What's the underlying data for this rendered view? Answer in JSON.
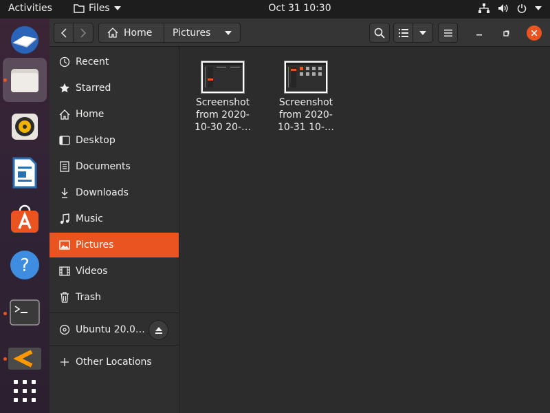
{
  "topbar": {
    "activities": "Activities",
    "app_name": "Files",
    "clock": "Oct 31  10:30"
  },
  "header": {
    "path": [
      {
        "label": "Home",
        "icon": "home-icon"
      },
      {
        "label": "Pictures"
      }
    ]
  },
  "sidebar": {
    "items": [
      {
        "label": "Recent",
        "icon": "clock-icon"
      },
      {
        "label": "Starred",
        "icon": "star-icon"
      },
      {
        "label": "Home",
        "icon": "home-icon"
      },
      {
        "label": "Desktop",
        "icon": "desktop-icon"
      },
      {
        "label": "Documents",
        "icon": "document-icon"
      },
      {
        "label": "Downloads",
        "icon": "download-icon"
      },
      {
        "label": "Music",
        "icon": "music-icon"
      },
      {
        "label": "Pictures",
        "icon": "picture-icon",
        "selected": true
      },
      {
        "label": "Videos",
        "icon": "film-icon"
      },
      {
        "label": "Trash",
        "icon": "trash-icon"
      }
    ],
    "device": {
      "label": "Ubuntu 20.0…",
      "icon": "disc-icon"
    },
    "other": {
      "label": "Other Locations",
      "icon": "plus-icon"
    }
  },
  "files": [
    {
      "name_lines": [
        "Screenshot",
        "from 2020-",
        "10-30 20-…"
      ]
    },
    {
      "name_lines": [
        "Screenshot",
        "from 2020-",
        "10-31 10-…"
      ]
    }
  ],
  "colors": {
    "accent": "#e95420",
    "topbar": "#1d1d1d",
    "sidebar": "#2f2f2f",
    "content": "#2c2c2c"
  }
}
